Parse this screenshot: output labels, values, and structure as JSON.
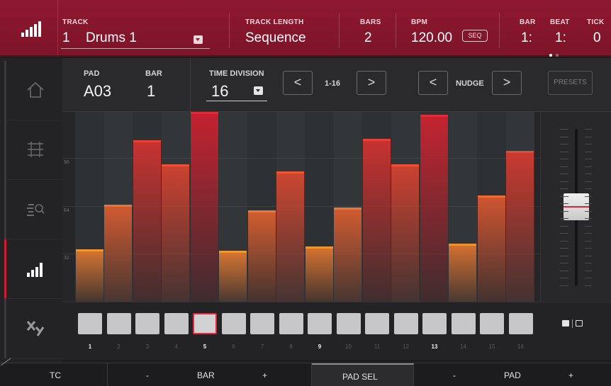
{
  "header": {
    "track_label": "TRACK",
    "track_number": "1",
    "track_name": "Drums 1",
    "track_length_label": "TRACK LENGTH",
    "track_length_value": "Sequence",
    "bars_label": "BARS",
    "bars_value": "2",
    "bpm_label": "BPM",
    "bpm_value": "120.00",
    "seq_badge": "SEQ",
    "bar_label": "BAR",
    "bar_value": "1:",
    "beat_label": "BEAT",
    "beat_value": "1:",
    "tick_label": "TICK",
    "tick_value": "0",
    "icon": "velocity-bars-icon"
  },
  "sidebar": {
    "items": [
      {
        "name": "home-icon",
        "active": false
      },
      {
        "name": "grid-icon",
        "active": false
      },
      {
        "name": "list-search-icon",
        "active": false
      },
      {
        "name": "velocity-bars-icon",
        "active": true
      },
      {
        "name": "xy-icon",
        "active": false
      }
    ]
  },
  "controls": {
    "pad_label": "PAD",
    "pad_value": "A03",
    "bar_label": "BAR",
    "bar_value": "1",
    "time_division_label": "TIME DIVISION",
    "time_division_value": "16",
    "prev_icon": "<",
    "next_icon": ">",
    "range_label": "1-16",
    "nudge_label": "NUDGE",
    "presets_label": "PRESETS"
  },
  "graph": {
    "tick_labels": [
      "96",
      "64",
      "32"
    ],
    "velocities": [
      35,
      65,
      108,
      92,
      127,
      34,
      61,
      87,
      37,
      63,
      109,
      92,
      125,
      39,
      71,
      101
    ]
  },
  "pads": {
    "numbers": [
      "1",
      "2",
      "3",
      "4",
      "5",
      "6",
      "7",
      "8",
      "9",
      "10",
      "11",
      "12",
      "13",
      "14",
      "15",
      "16"
    ],
    "highlighted": [
      1,
      5,
      9,
      13
    ],
    "selected": 5
  },
  "bottom": {
    "tc": "TC",
    "bar_minus": "-",
    "bar": "BAR",
    "bar_plus": "+",
    "pad_sel": "PAD SEL",
    "pad_minus": "-",
    "pad": "PAD",
    "pad_plus": "+"
  },
  "colors": {
    "header_red": "#8a1a2e",
    "accent_red": "#d6283c",
    "bar_low": "#e0a32a",
    "bar_high": "#c21f30"
  }
}
